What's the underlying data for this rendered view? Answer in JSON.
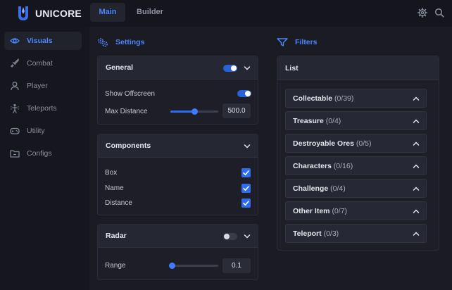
{
  "app": {
    "brand": "UNICORE",
    "accent": "#4b86ff"
  },
  "tabs": [
    {
      "label": "Main",
      "active": true
    },
    {
      "label": "Builder",
      "active": false
    }
  ],
  "header_icons": [
    "gear-icon",
    "search-icon"
  ],
  "sidebar": {
    "items": [
      {
        "label": "Visuals",
        "icon": "eye-icon",
        "active": true
      },
      {
        "label": "Combat",
        "icon": "sword-icon",
        "active": false
      },
      {
        "label": "Player",
        "icon": "user-icon",
        "active": false
      },
      {
        "label": "Teleports",
        "icon": "teleport-icon",
        "active": false
      },
      {
        "label": "Utility",
        "icon": "gamepad-icon",
        "active": false
      },
      {
        "label": "Configs",
        "icon": "folder-icon",
        "active": false
      }
    ]
  },
  "settings": {
    "title": "Settings",
    "general": {
      "title": "General",
      "enabled": true,
      "show_offscreen_label": "Show Offscreen",
      "show_offscreen": true,
      "max_distance_label": "Max Distance",
      "max_distance_value": "500.0",
      "max_distance_fraction": 0.5
    },
    "components": {
      "title": "Components",
      "items": [
        {
          "label": "Box",
          "checked": true
        },
        {
          "label": "Name",
          "checked": true
        },
        {
          "label": "Distance",
          "checked": true
        }
      ]
    },
    "radar": {
      "title": "Radar",
      "enabled": false,
      "range_label": "Range",
      "range_value": "0.1",
      "range_fraction": 0.03
    }
  },
  "filters": {
    "title": "Filters",
    "list_label": "List",
    "items": [
      {
        "label": "Collectable",
        "count": "(0/39)"
      },
      {
        "label": "Treasure",
        "count": "(0/4)"
      },
      {
        "label": "Destroyable Ores",
        "count": "(0/5)"
      },
      {
        "label": "Characters",
        "count": "(0/16)"
      },
      {
        "label": "Challenge",
        "count": "(0/4)"
      },
      {
        "label": "Other Item",
        "count": "(0/7)"
      },
      {
        "label": "Teleport",
        "count": "(0/3)"
      }
    ]
  }
}
